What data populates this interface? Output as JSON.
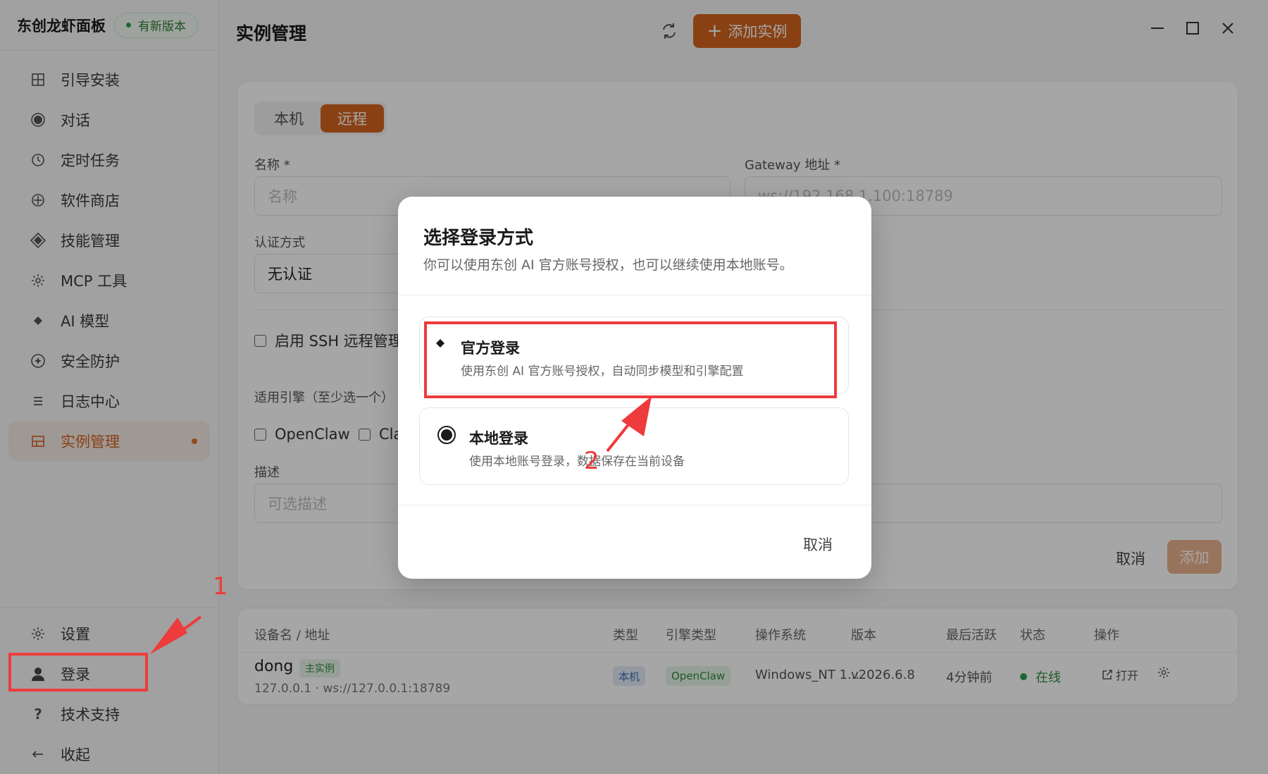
{
  "sidebar": {
    "brand": "东创龙虾面板",
    "update_badge": "有新版本",
    "items": [
      {
        "label": "引导安装",
        "icon": "grid-icon"
      },
      {
        "label": "对话",
        "icon": "chat-icon"
      },
      {
        "label": "定时任务",
        "icon": "clock-icon"
      },
      {
        "label": "软件商店",
        "icon": "store-icon"
      },
      {
        "label": "技能管理",
        "icon": "diamond-icon"
      },
      {
        "label": "MCP 工具",
        "icon": "gear-icon"
      },
      {
        "label": "AI 模型",
        "icon": "sparkle-icon"
      },
      {
        "label": "安全防护",
        "icon": "shield-icon"
      },
      {
        "label": "日志中心",
        "icon": "list-icon"
      },
      {
        "label": "实例管理",
        "icon": "instance-icon"
      }
    ],
    "bottom_items": [
      {
        "label": "设置",
        "icon": "gear-icon"
      },
      {
        "label": "登录",
        "icon": "user-icon"
      },
      {
        "label": "技术支持",
        "icon": "question-icon"
      },
      {
        "label": "收起",
        "icon": "arrow-left-icon"
      }
    ]
  },
  "header": {
    "title": "实例管理",
    "add_button": "添加实例"
  },
  "form": {
    "tabs": [
      "本机",
      "远程"
    ],
    "name_label": "名称 *",
    "name_placeholder": "名称",
    "gateway_label": "Gateway 地址 *",
    "gateway_placeholder": "ws://192.168.1.100:18789",
    "auth_label": "认证方式",
    "auth_value": "无认证",
    "ssh_label": "启用 SSH 远程管理",
    "engine_label": "适用引擎（至少选一个）",
    "engine_options": [
      "OpenClaw",
      "Cla"
    ],
    "desc_label": "描述",
    "desc_placeholder": "可选描述",
    "cancel": "取消",
    "submit": "添加"
  },
  "table": {
    "headers": [
      "设备名 / 地址",
      "类型",
      "引擎类型",
      "操作系统",
      "版本",
      "最后活跃",
      "状态",
      "操作"
    ],
    "rows": [
      {
        "name": "dong",
        "tag": "主实例",
        "address": "127.0.0.1 · ws://127.0.0.1:18789",
        "type": "本机",
        "engine": "OpenClaw",
        "os": "Windows_NT 1...",
        "version": "v2026.6.8",
        "last_active": "4分钟前",
        "status": "在线",
        "open": "打开"
      }
    ]
  },
  "modal": {
    "title": "选择登录方式",
    "subtitle": "你可以使用东创 AI 官方账号授权，也可以继续使用本地账号。",
    "options": [
      {
        "title": "官方登录",
        "desc": "使用东创 AI 官方账号授权，自动同步模型和引擎配置"
      },
      {
        "title": "本地登录",
        "desc": "使用本地账号登录，数据保存在当前设备"
      }
    ],
    "cancel": "取消"
  },
  "annotations": {
    "step1": "1",
    "step2": "2",
    "color": "#ee3b3b"
  },
  "colors": {
    "accent": "#d3651f",
    "online": "#2e9e4a"
  }
}
